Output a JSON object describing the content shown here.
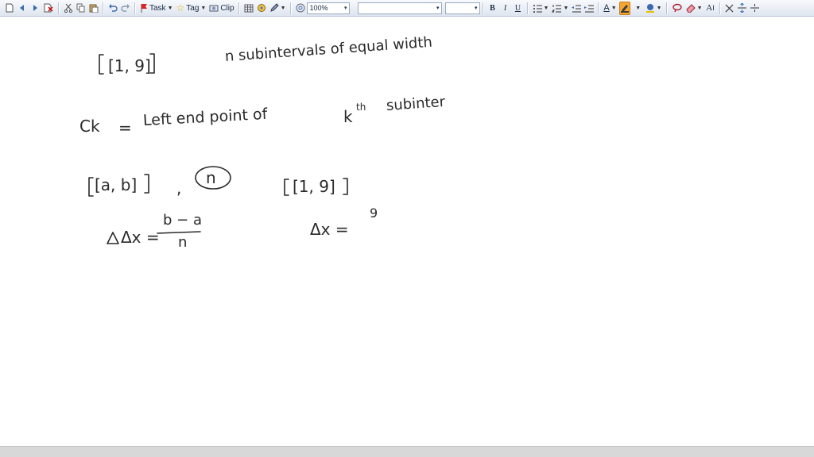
{
  "toolbar": {
    "task_label": "Task",
    "tag_label": "Tag",
    "clip_label": "Clip",
    "zoom_value": "100%",
    "font_name": "",
    "font_size": "",
    "bold": "B",
    "italic": "I",
    "underline": "U",
    "font_color_glyph": "A",
    "style_glyph": "A",
    "highlight_color": "#f7a531"
  },
  "note": {
    "line1_interval": "[1, 9]",
    "line1_text": "n subintervals of equal width",
    "line2_ck": "Ck",
    "line2_eq": "=",
    "line2_text": "Left end point of",
    "line2_k": "k",
    "line2_th": "th",
    "line2_tail": "subinter",
    "line3_interval_ab": "[a, b]",
    "line3_comma": ",",
    "line3_n": "n",
    "line3_interval_19": "[1, 9]",
    "dx_left": "Δx =",
    "dx_num": "b − a",
    "dx_den": "n",
    "dx_right": "Δx =",
    "dx_right_num": "9"
  }
}
